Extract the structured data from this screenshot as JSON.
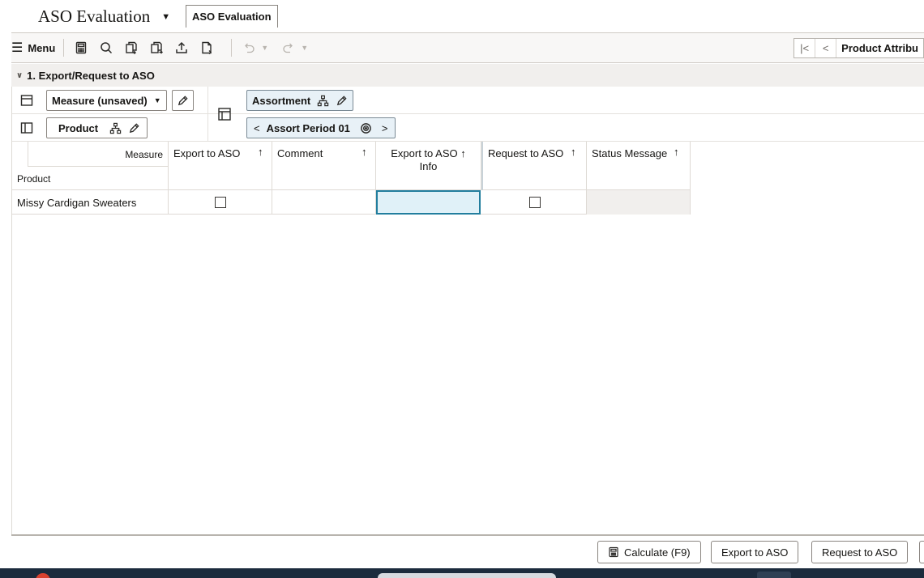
{
  "app": {
    "title": "ASO Evaluation",
    "tab_label": "ASO Evaluation"
  },
  "toolbar": {
    "menu_label": "Menu",
    "nav_label": "Product Attribu"
  },
  "section": {
    "title": "1. Export/Request to ASO"
  },
  "pivot": {
    "measure_chip": "Measure (unsaved)",
    "assortment_chip": "Assortment",
    "product_chip": "Product",
    "period_chip": "Assort Period 01"
  },
  "grid": {
    "corner_measure": "Measure",
    "corner_product": "Product",
    "columns": [
      {
        "label": "Export to ASO",
        "arrow": "↑"
      },
      {
        "label": "Comment",
        "arrow": "↑"
      },
      {
        "label": "Export to ASO",
        "label2": "Info",
        "arrow": "↑"
      },
      {
        "label": "Request to ASO",
        "arrow": "↑"
      },
      {
        "label": "Status Message",
        "arrow": "↑"
      }
    ],
    "rows": [
      {
        "product": "Missy Cardigan Sweaters",
        "export": false,
        "comment": "",
        "info": "",
        "request": false,
        "status": ""
      }
    ]
  },
  "footer": {
    "calculate": "Calculate (F9)",
    "export": "Export to ASO",
    "request": "Request to ASO"
  }
}
